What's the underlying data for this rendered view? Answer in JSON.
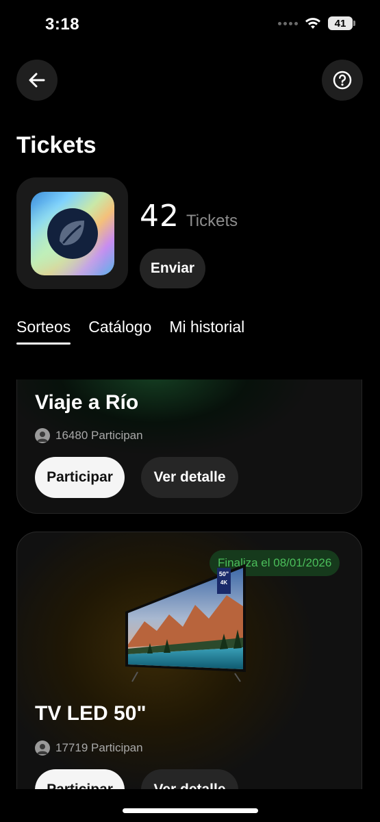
{
  "status_bar": {
    "time": "3:18",
    "battery": "41"
  },
  "header": {
    "title": "Tickets"
  },
  "balance": {
    "amount": "42",
    "unit": "Tickets",
    "send_label": "Enviar"
  },
  "tabs": [
    {
      "label": "Sorteos",
      "active": true
    },
    {
      "label": "Catálogo",
      "active": false
    },
    {
      "label": "Mi historial",
      "active": false
    }
  ],
  "raffles": [
    {
      "title": "Viaje a Río",
      "participants": "16480 Participan",
      "participate_label": "Participar",
      "detail_label": "Ver detalle"
    },
    {
      "title": "TV LED 50\"",
      "participants": "17719 Participan",
      "badge": "Finaliza el 08/01/2026",
      "participate_label": "Participar",
      "detail_label": "Ver detalle",
      "image_labels": {
        "size": "50\"",
        "res": "4K"
      }
    }
  ],
  "colors": {
    "background": "#000000",
    "card": "#111111",
    "badge_text": "#4bbf5b",
    "badge_bg": "#163a1c"
  },
  "icons": [
    "arrow-left-icon",
    "question-circle-icon",
    "wifi-icon",
    "battery-icon",
    "leaf-logo-icon",
    "avatar-icon"
  ]
}
